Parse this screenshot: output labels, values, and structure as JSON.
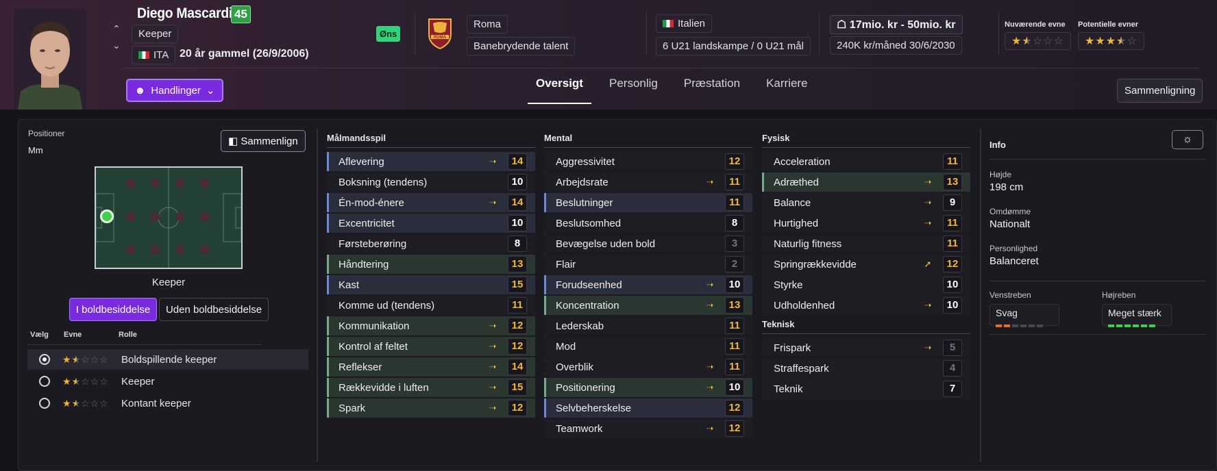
{
  "player": {
    "name": "Diego Mascardi",
    "ability": "45",
    "position": "Keeper",
    "nation_code": "ITA",
    "age_text": "20 år gammel (26/9/2006)",
    "wanted_badge": "Øns"
  },
  "club": {
    "name": "Roma",
    "status": "Banebrydende talent",
    "crest_text": "ROMA"
  },
  "nation": {
    "name": "Italien",
    "caps": "6 U21 landskampe / 0 U21 mål"
  },
  "contract": {
    "value_range": "17mio. kr - 50mio. kr",
    "wage": "240K kr/måned",
    "expiry": "30/6/2030"
  },
  "ratings": {
    "current_label": "Nuværende evne",
    "potential_label": "Potentielle evner",
    "current_stars": 1.5,
    "potential_stars": 3.5
  },
  "actions": {
    "actions_label": "Handlinger",
    "compare_label": "Sammenligning",
    "compare_short": "Sammenlign"
  },
  "tabs": [
    {
      "label": "Oversigt",
      "active": true
    },
    {
      "label": "Personlig",
      "active": false
    },
    {
      "label": "Præstation",
      "active": false
    },
    {
      "label": "Karriere",
      "active": false
    }
  ],
  "positions": {
    "label": "Positioner",
    "value": "Mm",
    "pitch_caption": "Keeper"
  },
  "possession": {
    "in_label": "I boldbesiddelse",
    "out_label": "Uden boldbesiddelse"
  },
  "roles": {
    "headers": [
      "Vælg",
      "Evne",
      "Rolle"
    ],
    "items": [
      {
        "name": "Boldspillende keeper",
        "selected": true,
        "stars": 1.5
      },
      {
        "name": "Keeper",
        "selected": false,
        "stars": 1.5
      },
      {
        "name": "Kontant keeper",
        "selected": false,
        "stars": 1.5
      }
    ]
  },
  "attributes": {
    "goalkeeping": {
      "title": "Målmandsspil",
      "items": [
        {
          "name": "Aflevering",
          "value": "14",
          "trend": "up-slight",
          "hl": "blue",
          "color": "orange"
        },
        {
          "name": "Boksning (tendens)",
          "value": "10",
          "trend": "",
          "hl": "",
          "color": "white"
        },
        {
          "name": "Én-mod-énere",
          "value": "14",
          "trend": "up-slight",
          "hl": "blue",
          "color": "orange"
        },
        {
          "name": "Excentricitet",
          "value": "10",
          "trend": "",
          "hl": "blue",
          "color": "white"
        },
        {
          "name": "Førsteberøring",
          "value": "8",
          "trend": "",
          "hl": "",
          "color": "white"
        },
        {
          "name": "Håndtering",
          "value": "13",
          "trend": "",
          "hl": "green",
          "color": "orange"
        },
        {
          "name": "Kast",
          "value": "15",
          "trend": "",
          "hl": "blue",
          "color": "orange"
        },
        {
          "name": "Komme ud (tendens)",
          "value": "11",
          "trend": "",
          "hl": "",
          "color": "orange"
        },
        {
          "name": "Kommunikation",
          "value": "12",
          "trend": "up-slight",
          "hl": "green",
          "color": "orange"
        },
        {
          "name": "Kontrol af feltet",
          "value": "12",
          "trend": "up-slight",
          "hl": "green",
          "color": "orange"
        },
        {
          "name": "Reflekser",
          "value": "14",
          "trend": "up-slight",
          "hl": "green",
          "color": "orange"
        },
        {
          "name": "Rækkevidde i luften",
          "value": "15",
          "trend": "up-slight",
          "hl": "green",
          "color": "orange"
        },
        {
          "name": "Spark",
          "value": "12",
          "trend": "up-slight",
          "hl": "green",
          "color": "orange"
        }
      ]
    },
    "mental": {
      "title": "Mental",
      "items": [
        {
          "name": "Aggressivitet",
          "value": "12",
          "trend": "",
          "hl": "",
          "color": "orange"
        },
        {
          "name": "Arbejdsrate",
          "value": "11",
          "trend": "up-slight",
          "hl": "",
          "color": "orange"
        },
        {
          "name": "Beslutninger",
          "value": "11",
          "trend": "",
          "hl": "blue",
          "color": "orange"
        },
        {
          "name": "Beslutsomhed",
          "value": "8",
          "trend": "",
          "hl": "",
          "color": "white"
        },
        {
          "name": "Bevægelse uden bold",
          "value": "3",
          "trend": "",
          "hl": "",
          "color": "grey"
        },
        {
          "name": "Flair",
          "value": "2",
          "trend": "",
          "hl": "",
          "color": "grey"
        },
        {
          "name": "Forudseenhed",
          "value": "10",
          "trend": "up-slight",
          "hl": "blue",
          "color": "white"
        },
        {
          "name": "Koncentration",
          "value": "13",
          "trend": "up-slight",
          "hl": "green",
          "color": "orange"
        },
        {
          "name": "Lederskab",
          "value": "11",
          "trend": "",
          "hl": "",
          "color": "orange"
        },
        {
          "name": "Mod",
          "value": "11",
          "trend": "",
          "hl": "",
          "color": "orange"
        },
        {
          "name": "Overblik",
          "value": "11",
          "trend": "up-slight",
          "hl": "",
          "color": "orange"
        },
        {
          "name": "Positionering",
          "value": "10",
          "trend": "up-slight",
          "hl": "green",
          "color": "white"
        },
        {
          "name": "Selvbeherskelse",
          "value": "12",
          "trend": "",
          "hl": "blue",
          "color": "orange"
        },
        {
          "name": "Teamwork",
          "value": "12",
          "trend": "up-slight",
          "hl": "",
          "color": "orange"
        }
      ]
    },
    "physical": {
      "title": "Fysisk",
      "items": [
        {
          "name": "Acceleration",
          "value": "11",
          "trend": "",
          "hl": "",
          "color": "orange"
        },
        {
          "name": "Adræthed",
          "value": "13",
          "trend": "up-slight",
          "hl": "green",
          "color": "orange"
        },
        {
          "name": "Balance",
          "value": "9",
          "trend": "up-slight",
          "hl": "",
          "color": "white"
        },
        {
          "name": "Hurtighed",
          "value": "11",
          "trend": "up-slight",
          "hl": "",
          "color": "orange"
        },
        {
          "name": "Naturlig fitness",
          "value": "11",
          "trend": "",
          "hl": "",
          "color": "orange"
        },
        {
          "name": "Springrækkevidde",
          "value": "12",
          "trend": "up",
          "hl": "",
          "color": "orange"
        },
        {
          "name": "Styrke",
          "value": "10",
          "trend": "",
          "hl": "",
          "color": "white"
        },
        {
          "name": "Udholdenhed",
          "value": "10",
          "trend": "up-slight",
          "hl": "",
          "color": "white"
        }
      ]
    },
    "technical": {
      "title": "Teknisk",
      "items": [
        {
          "name": "Frispark",
          "value": "5",
          "trend": "up-slight",
          "hl": "",
          "color": "grey"
        },
        {
          "name": "Straffespark",
          "value": "4",
          "trend": "",
          "hl": "",
          "color": "grey"
        },
        {
          "name": "Teknik",
          "value": "7",
          "trend": "",
          "hl": "",
          "color": "white"
        }
      ]
    }
  },
  "info": {
    "title": "Info",
    "height_label": "Højde",
    "height_value": "198 cm",
    "reputation_label": "Omdømme",
    "reputation_value": "Nationalt",
    "personality_label": "Personlighed",
    "personality_value": "Balanceret",
    "left_foot_label": "Venstreben",
    "left_foot_value": "Svag",
    "left_foot_level": 2,
    "right_foot_label": "Højreben",
    "right_foot_value": "Meget stærk",
    "right_foot_level": 6
  },
  "colors": {
    "accent": "#7a2be0",
    "attr_orange": "#f3b73c",
    "trend_yellow": "#f1c232",
    "ability_green": "#2fa043"
  }
}
